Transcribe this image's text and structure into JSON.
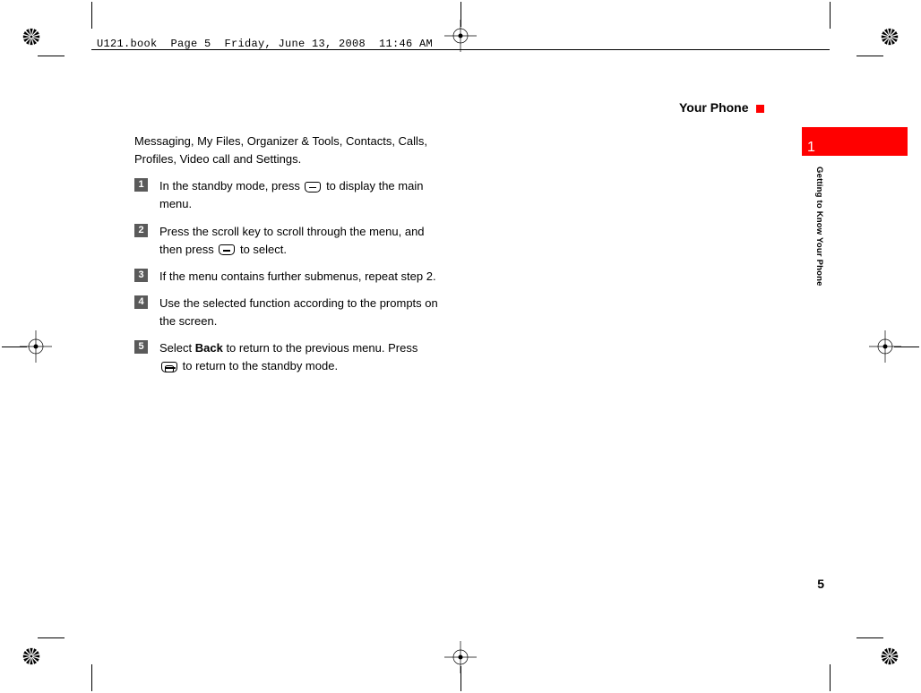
{
  "stamp": "U121.book  Page 5  Friday, June 13, 2008  11:46 AM",
  "running_header": "Your Phone",
  "tab_number": "1",
  "chapter_title": "Getting to Know Your Phone",
  "intro": "Messaging, My Files, Organizer & Tools, Contacts, Calls, Profiles, Video call and Settings.",
  "steps": {
    "s1": {
      "num": "1",
      "pre": "In the standby mode, press ",
      "post": " to display the main menu."
    },
    "s2": {
      "num": "2",
      "pre": "Press the scroll key to scroll through the menu, and then press ",
      "post": " to select."
    },
    "s3": {
      "num": "3",
      "text": "If the menu contains further submenus, repeat step 2."
    },
    "s4": {
      "num": "4",
      "text": "Use the selected function according to the prompts on the screen."
    },
    "s5": {
      "num": "5",
      "pre1": "Select ",
      "bold": "Back",
      "pre2": " to return to the previous menu. Press ",
      "post": " to return to the standby mode."
    }
  },
  "page_number": "5"
}
